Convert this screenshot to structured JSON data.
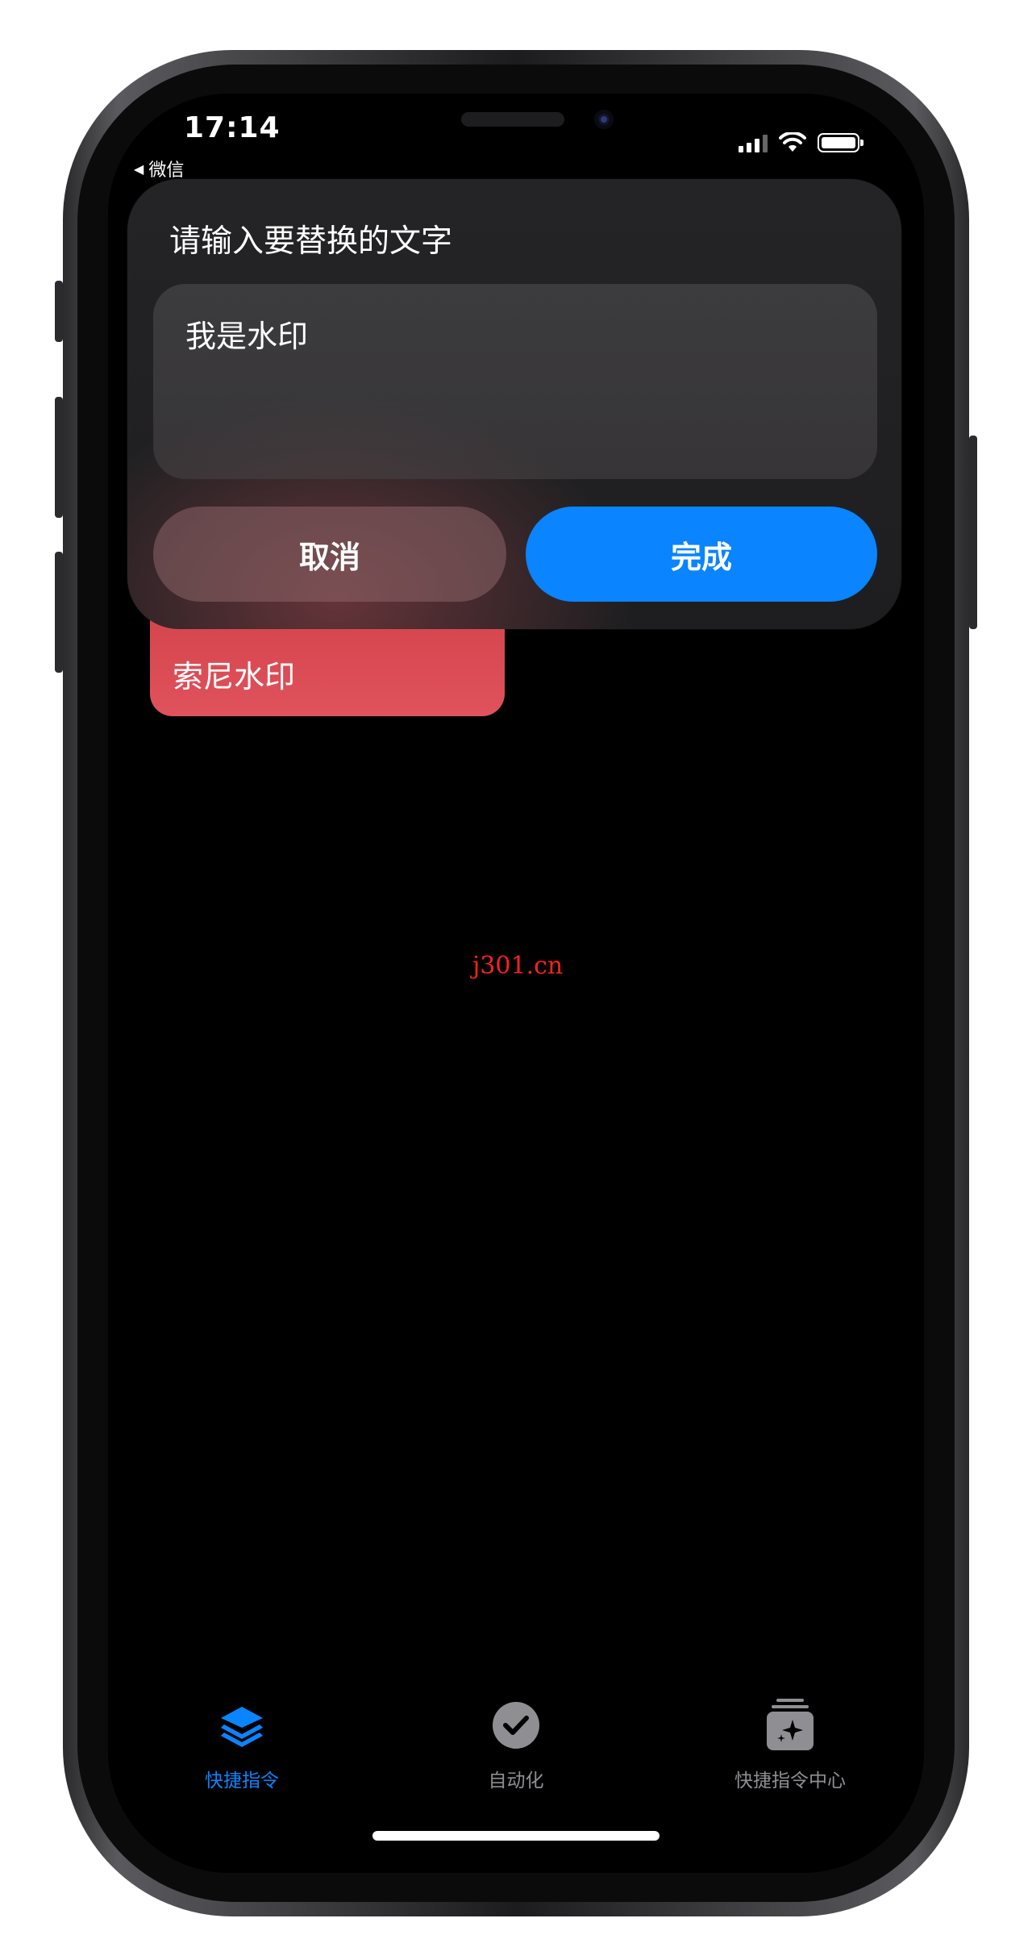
{
  "status_bar": {
    "time": "17:14",
    "back_app": "微信",
    "back_glyph": "◀"
  },
  "dialog": {
    "title": "请输入要替换的文字",
    "input_value": "我是水印",
    "cancel_label": "取消",
    "done_label": "完成"
  },
  "shortcut_card": {
    "label": "索尼水印",
    "color": "#e0525c"
  },
  "watermark": "j301.cn",
  "tab_bar": {
    "tabs": [
      {
        "label": "快捷指令",
        "icon": "layers-icon",
        "active": true
      },
      {
        "label": "自动化",
        "icon": "clock-check-icon",
        "active": false
      },
      {
        "label": "快捷指令中心",
        "icon": "gallery-sparkle-icon",
        "active": false
      }
    ]
  },
  "colors": {
    "accent": "#0a84ff",
    "background": "#000000",
    "card_red": "#e0525c"
  }
}
